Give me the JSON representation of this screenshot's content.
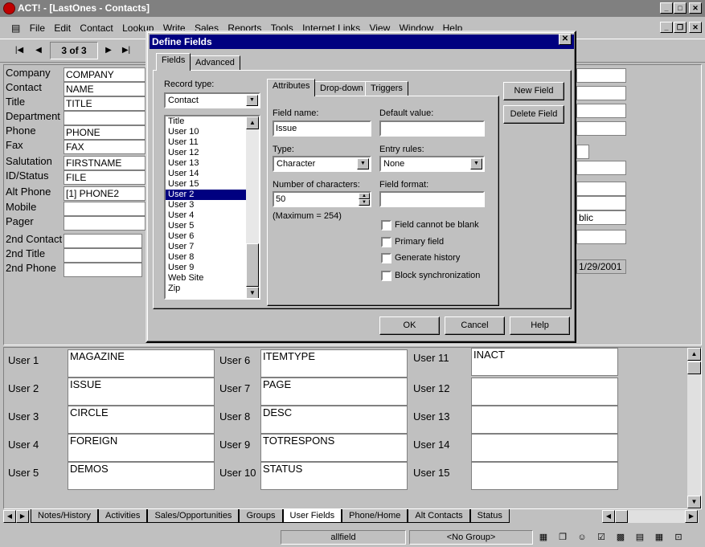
{
  "window": {
    "title": "ACT! - [LastOnes - Contacts]"
  },
  "menu": [
    "File",
    "Edit",
    "Contact",
    "Lookup",
    "Write",
    "Sales",
    "Reports",
    "Tools",
    "Internet Links",
    "View",
    "Window",
    "Help"
  ],
  "record_nav": {
    "position": "3 of 3"
  },
  "contact_fields": [
    {
      "label": "Company",
      "value": "COMPANY"
    },
    {
      "label": "Contact",
      "value": "NAME"
    },
    {
      "label": "Title",
      "value": "TITLE"
    },
    {
      "label": "Department",
      "value": ""
    },
    {
      "label": "Phone",
      "value": "PHONE"
    },
    {
      "label": "Fax",
      "value": "FAX"
    },
    {
      "label": "Salutation",
      "value": "FIRSTNAME"
    },
    {
      "label": "ID/Status",
      "value": "FILE"
    },
    {
      "label": "Alt Phone",
      "value": "[1] PHONE2"
    },
    {
      "label": "Mobile",
      "value": ""
    },
    {
      "label": "Pager",
      "value": ""
    },
    {
      "label": "2nd Contact",
      "value": ""
    },
    {
      "label": "2nd Title",
      "value": ""
    },
    {
      "label": "2nd Phone",
      "value": ""
    }
  ],
  "right_fields": {
    "public_text": "blic",
    "date_text": "1/29/2001"
  },
  "user_fields": [
    {
      "label": "User 1",
      "value": "MAGAZINE"
    },
    {
      "label": "User 2",
      "value": "ISSUE"
    },
    {
      "label": "User 3",
      "value": "CIRCLE"
    },
    {
      "label": "User 4",
      "value": "FOREIGN"
    },
    {
      "label": "User 5",
      "value": "DEMOS"
    },
    {
      "label": "User 6",
      "value": "ITEMTYPE"
    },
    {
      "label": "User 7",
      "value": "PAGE"
    },
    {
      "label": "User 8",
      "value": "DESC"
    },
    {
      "label": "User 9",
      "value": "TOTRESPONS"
    },
    {
      "label": "User 10",
      "value": "STATUS"
    },
    {
      "label": "User 11",
      "value": "INACT"
    },
    {
      "label": "User 12",
      "value": ""
    },
    {
      "label": "User 13",
      "value": ""
    },
    {
      "label": "User 14",
      "value": ""
    },
    {
      "label": "User 15",
      "value": ""
    }
  ],
  "bottom_tabs": [
    "Notes/History",
    "Activities",
    "Sales/Opportunities",
    "Groups",
    "User Fields",
    "Phone/Home",
    "Alt Contacts",
    "Status"
  ],
  "active_bottom_tab": "User Fields",
  "status": {
    "field": "allfield",
    "group": "<No Group>"
  },
  "dialog": {
    "title": "Define Fields",
    "tabs": [
      "Fields",
      "Advanced"
    ],
    "record_type_label": "Record type:",
    "record_type_value": "Contact",
    "field_list": [
      "Title",
      "User 10",
      "User 11",
      "User 12",
      "User 13",
      "User 14",
      "User 15",
      "User 2",
      "User 3",
      "User 4",
      "User 5",
      "User 6",
      "User 7",
      "User 8",
      "User 9",
      "Web Site",
      "Zip"
    ],
    "selected_field": "User 2",
    "inner_tabs": [
      "Attributes",
      "Drop-down",
      "Triggers"
    ],
    "field_name_label": "Field name:",
    "field_name_value": "Issue",
    "default_value_label": "Default value:",
    "default_value_value": "",
    "type_label": "Type:",
    "type_value": "Character",
    "entry_rules_label": "Entry rules:",
    "entry_rules_value": "None",
    "num_chars_label": "Number of characters:",
    "num_chars_value": "50",
    "max_note": "(Maximum = 254)",
    "field_format_label": "Field format:",
    "field_format_value": "",
    "checkboxes": [
      "Field cannot be blank",
      "Primary field",
      "Generate history",
      "Block synchronization"
    ],
    "new_field": "New Field",
    "delete_field": "Delete Field",
    "ok": "OK",
    "cancel": "Cancel",
    "help": "Help"
  }
}
